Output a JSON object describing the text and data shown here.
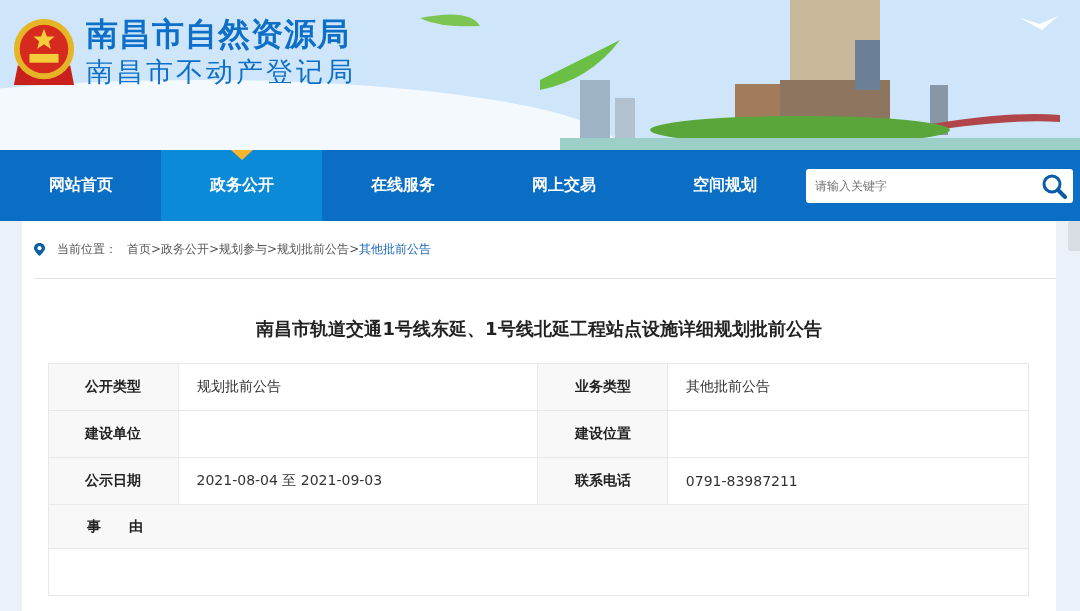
{
  "header": {
    "title": "南昌市自然资源局",
    "subtitle": "南昌市不动产登记局"
  },
  "nav": {
    "items": [
      {
        "label": "网站首页",
        "selected": false
      },
      {
        "label": "政务公开",
        "selected": true
      },
      {
        "label": "在线服务",
        "selected": false
      },
      {
        "label": "网上交易",
        "selected": false
      },
      {
        "label": "空间规划",
        "selected": false
      }
    ],
    "search": {
      "placeholder": "请输入关键字"
    }
  },
  "breadcrumb": {
    "label": "当前位置：",
    "trail": "首页>政务公开>规划参与>规划批前公告>",
    "current": "其他批前公告"
  },
  "article": {
    "title": "南昌市轨道交通1号线东延、1号线北延工程站点设施详细规划批前公告"
  },
  "table": {
    "rows": [
      [
        {
          "label": "公开类型",
          "value": "规划批前公告"
        },
        {
          "label": "业务类型",
          "value": "其他批前公告"
        }
      ],
      [
        {
          "label": "建设单位"
        },
        {
          "label": "建设位置"
        }
      ],
      [
        {
          "label": "公示日期",
          "value": "2021-08-04 至 2021-09-03"
        },
        {
          "label": "联系电话",
          "value": "0791-83987211"
        }
      ]
    ],
    "reason_label": "事　　由"
  }
}
